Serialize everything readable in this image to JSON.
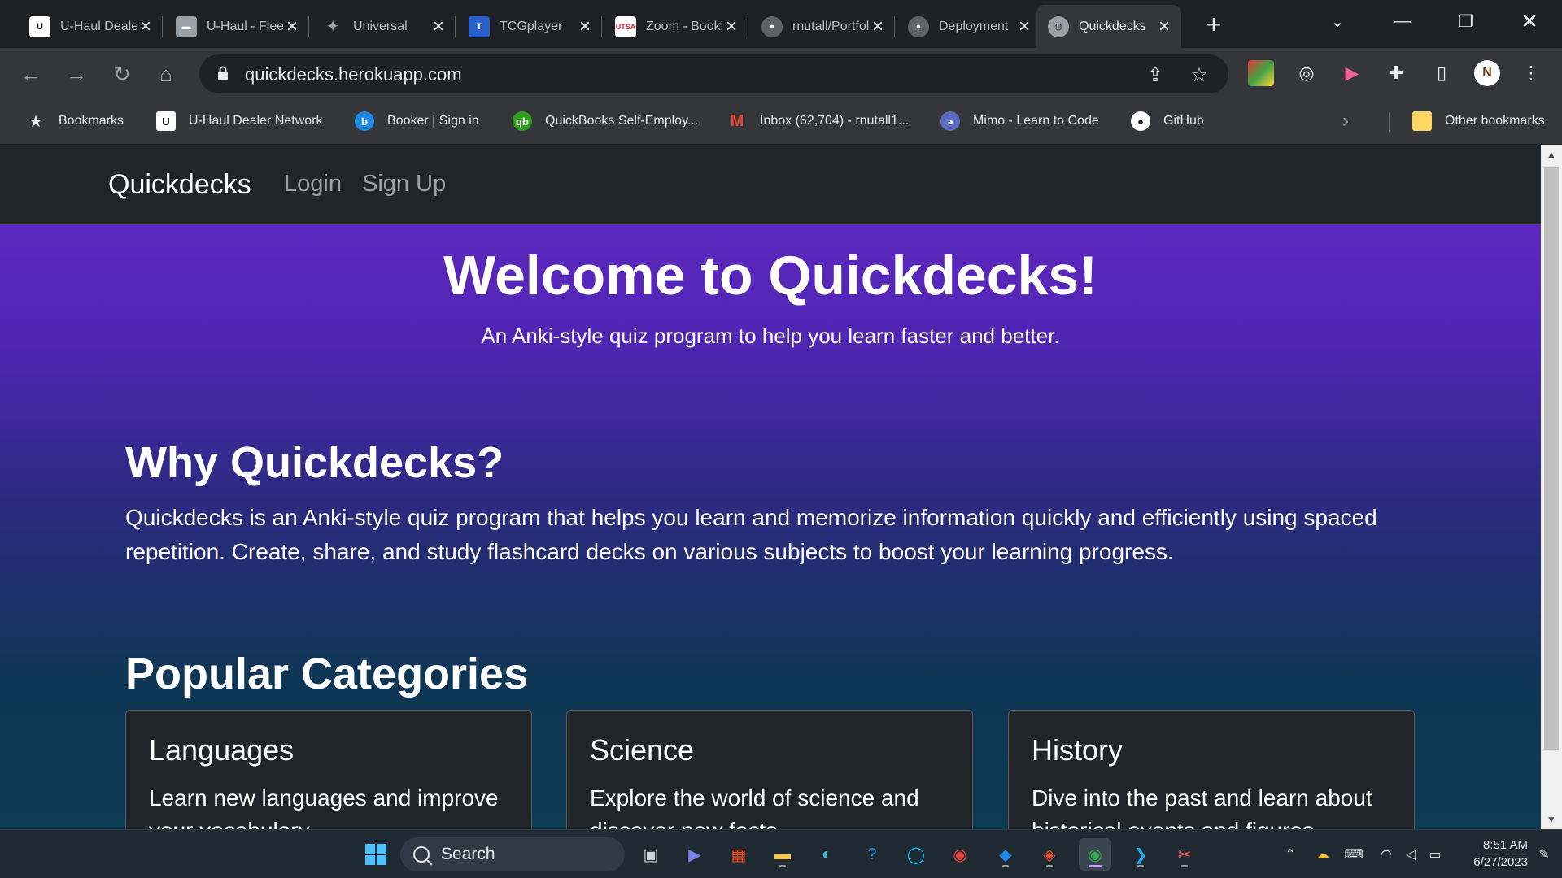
{
  "browser": {
    "tabs": [
      {
        "title": "U-Haul Dealer Network",
        "active": false
      },
      {
        "title": "U-Haul - Fleet",
        "active": false
      },
      {
        "title": "Universal",
        "active": false
      },
      {
        "title": "TCGplayer",
        "active": false
      },
      {
        "title": "Zoom - Booking",
        "active": false
      },
      {
        "title": "rnutall/Portfolio",
        "active": false
      },
      {
        "title": "Deployment",
        "active": false
      },
      {
        "title": "Quickdecks",
        "active": true
      }
    ],
    "new_tab": "+",
    "address": "quickdecks.herokuapp.com",
    "bookmarks": [
      {
        "label": "Bookmarks"
      },
      {
        "label": "U-Haul Dealer Network"
      },
      {
        "label": "Booker | Sign in"
      },
      {
        "label": "QuickBooks Self-Employ..."
      },
      {
        "label": "Inbox (62,704) - rnutall1..."
      },
      {
        "label": "Mimo - Learn to Code"
      },
      {
        "label": "GitHub"
      }
    ],
    "other_bookmarks": "Other bookmarks",
    "profile_initial": "N",
    "colors": {
      "tab_bg": "#202124",
      "toolbar_bg": "#35363a"
    }
  },
  "site": {
    "brand": "Quickdecks",
    "nav": {
      "login": "Login",
      "signup": "Sign Up"
    },
    "hero": {
      "title": "Welcome to Quickdecks!",
      "subtitle": "An Anki-style quiz program to help you learn faster and better."
    },
    "why": {
      "title": "Why Quickdecks?",
      "body": "Quickdecks is an Anki-style quiz program that helps you learn and memorize information quickly and efficiently using spaced repetition. Create, share, and study flashcard decks on various subjects to boost your learning progress."
    },
    "popular": {
      "title": "Popular Categories",
      "cards": [
        {
          "title": "Languages",
          "text": "Learn new languages and improve your vocabulary."
        },
        {
          "title": "Science",
          "text": "Explore the world of science and discover new facts."
        },
        {
          "title": "History",
          "text": "Dive into the past and learn about historical events and figures."
        }
      ]
    },
    "colors": {
      "gradient_top": "#6529c4",
      "gradient_bottom": "#0c3b52",
      "navbar": "#212529",
      "card": "#212529"
    }
  },
  "taskbar": {
    "search_label": "Search",
    "time": "8:51 AM",
    "date": "6/27/2023"
  }
}
